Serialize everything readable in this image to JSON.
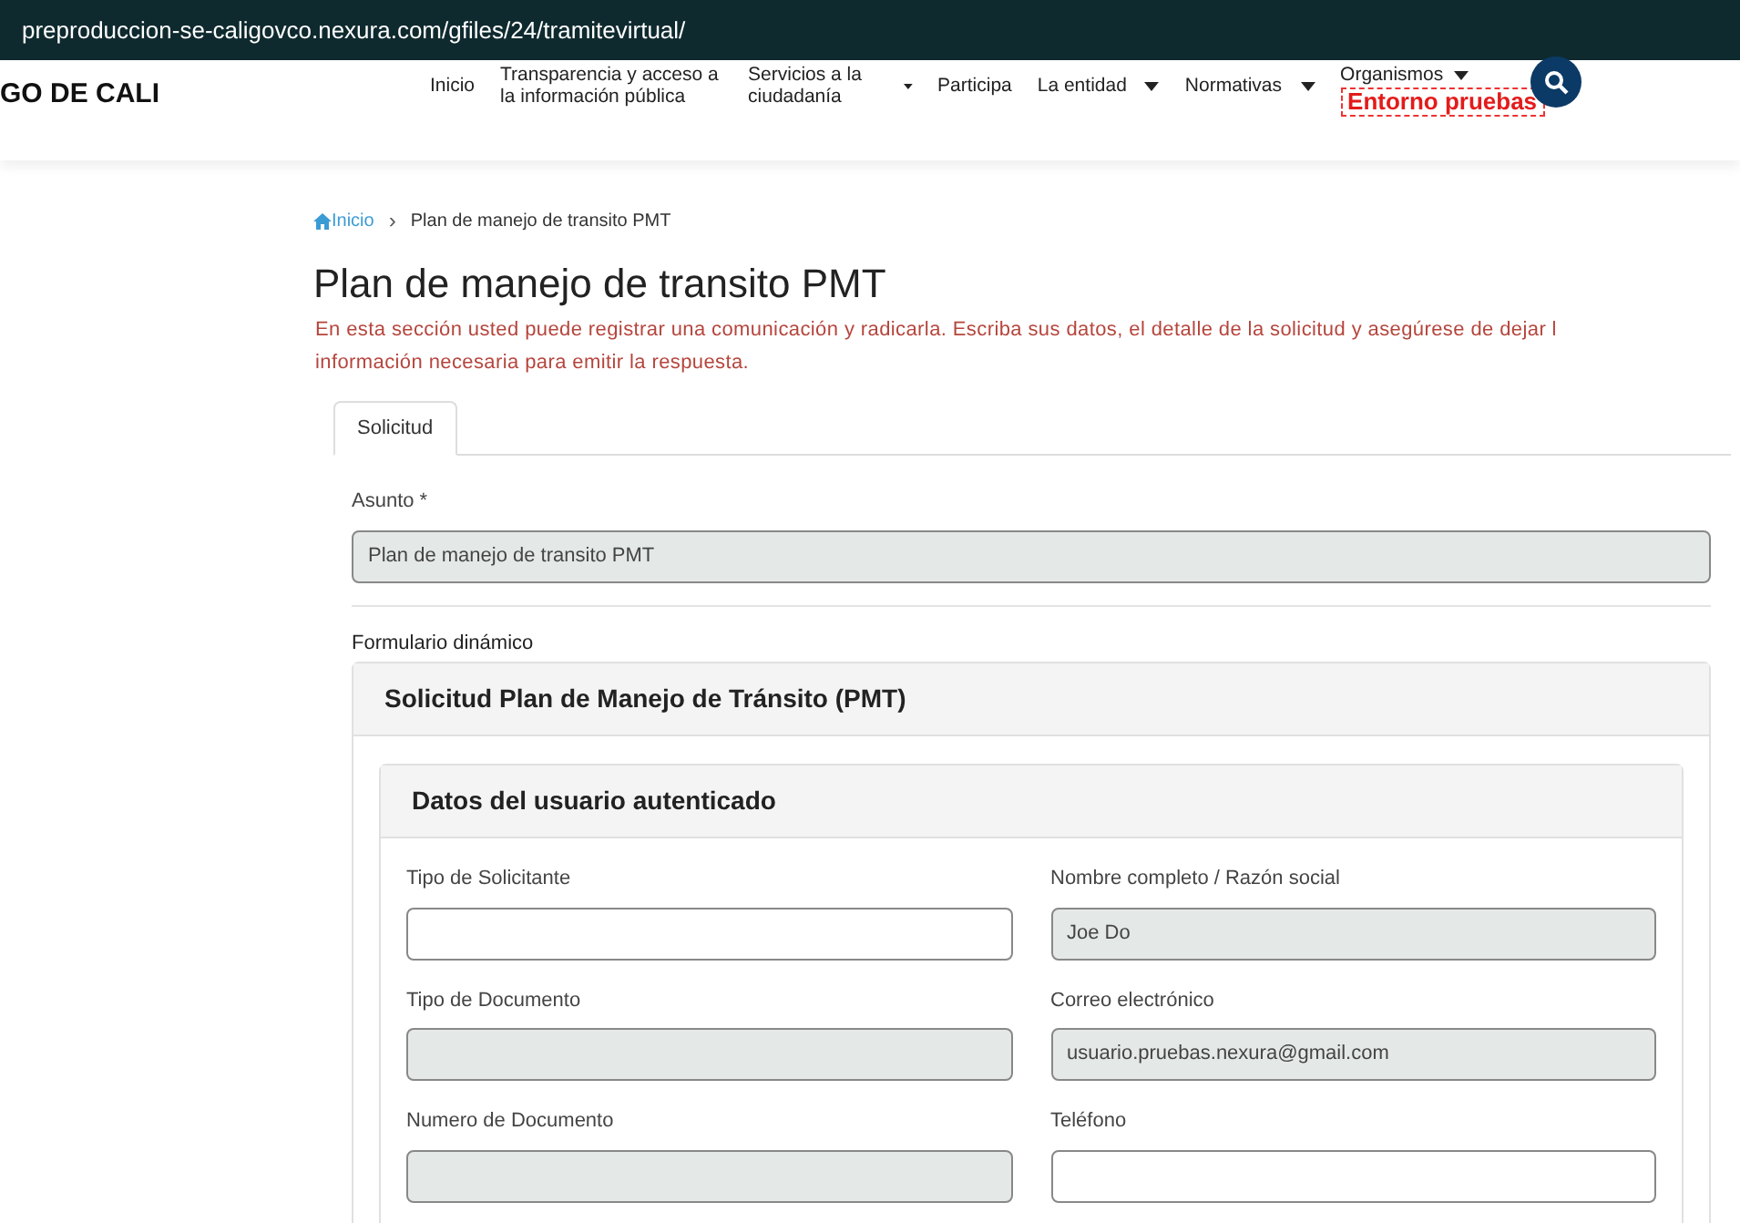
{
  "address_bar": {
    "url": "preproduccion-se-caligovco.nexura.com/gfiles/24/tramitevirtual/"
  },
  "header": {
    "logo": "GO DE CALI",
    "nav": [
      {
        "label": "Inicio",
        "dropdown": false
      },
      {
        "label": "Transparencia y acceso a la información pública",
        "dropdown": false
      },
      {
        "label": "Servicios a la ciudadanía",
        "dropdown": true
      },
      {
        "label": "Participa",
        "dropdown": false
      },
      {
        "label": "La entidad",
        "dropdown": true
      },
      {
        "label": "Normativas",
        "dropdown": true
      },
      {
        "label": "Organismos",
        "dropdown": true
      }
    ],
    "environment_badge": "Entorno pruebas"
  },
  "breadcrumb": [
    {
      "label": "Inicio",
      "kind": "link"
    },
    {
      "label": "›",
      "kind": "separator"
    },
    {
      "label": "Plan de manejo de transito PMT",
      "kind": "current"
    }
  ],
  "title": "Plan de manejo de transito PMT",
  "intro": [
    "En esta sección usted puede registrar una comunicación y radicarla. Escriba sus datos, el detalle de la solicitud y asegúrese de dejar l",
    "información necesaria para emitir la respuesta."
  ],
  "tabs": [
    {
      "label": "Solicitud",
      "selected": true
    }
  ],
  "subject": {
    "label": "Asunto *",
    "value": "Plan de manejo de transito PMT",
    "disabled": true
  },
  "dynamic_form": {
    "label": "Formulario dinámico",
    "title": "Solicitud Plan de Manejo de Tránsito (PMT)",
    "section": {
      "title": "Datos del usuario autenticado",
      "fields": [
        {
          "label": "Tipo de Solicitante",
          "disabled": false
        },
        {
          "label": "Nombre completo / Razón social",
          "value": "Joe Do",
          "disabled": true
        },
        {
          "label": "Tipo de Documento",
          "disabled": true
        },
        {
          "label": "Correo electrónico",
          "value": "usuario.pruebas.nexura@gmail.com",
          "disabled": true
        },
        {
          "label": "Numero de Documento",
          "disabled": true
        },
        {
          "label": "Teléfono",
          "disabled": false
        }
      ]
    }
  }
}
